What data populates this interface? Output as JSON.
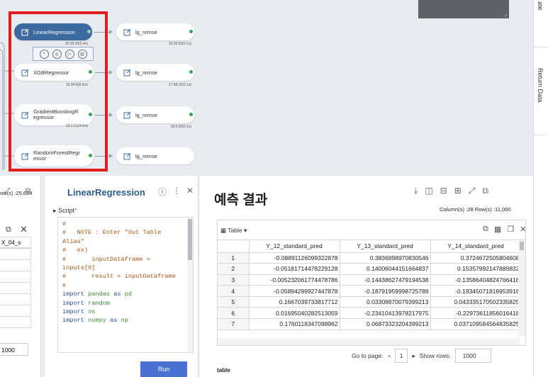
{
  "workflow": {
    "nodes": [
      {
        "label": "LinearRegression",
        "time": "16:26:39(5.4s)",
        "active": true
      },
      {
        "label": "XGBRegressor",
        "time": "16:34:6(8.9m)",
        "active": false
      },
      {
        "label": "GradientBoostingR\negressor",
        "time": "18:2:21(4.0m)",
        "active": false
      },
      {
        "label": "RandomForestRegr\nessor",
        "time": "",
        "active": false
      }
    ],
    "targets": [
      {
        "label": "lg_nrmse",
        "time": "16:26:53(0.1s)"
      },
      {
        "label": "lg_nrmse",
        "time": "17:58:15(0.1s)"
      },
      {
        "label": "lg_nrmse",
        "time": "18:5:39(0.1s)"
      },
      {
        "label": "lg_nrmse",
        "time": ""
      }
    ],
    "tool_icons": [
      "stop-icon",
      "group-icon",
      "play-icon",
      "delete-icon"
    ]
  },
  "side_tabs": [
    "ate",
    "Return Data"
  ],
  "left_panel": {
    "rows_text": "ow(s) :25,664",
    "column_header": "X_04_s",
    "page_size": "1000"
  },
  "script_panel": {
    "title": "LinearRegression",
    "script_label": "Script",
    "required_mark": "*",
    "code_lines": [
      {
        "type": "c",
        "text": "#"
      },
      {
        "type": "c",
        "text": "#   NOTE : Enter \"Out Table"
      },
      {
        "type": "c",
        "text": "Alias\""
      },
      {
        "type": "c",
        "text": "#   ex)"
      },
      {
        "type": "c",
        "text": "#       inputDataframe ="
      },
      {
        "type": "c",
        "text": "inputs[0]"
      },
      {
        "type": "c",
        "text": "#       result = inputDataframe"
      },
      {
        "type": "c",
        "text": "#"
      },
      {
        "type": "i",
        "kw": "import",
        "mod": "pandas",
        "as": "as",
        "alias": "pd"
      },
      {
        "type": "i",
        "kw": "import",
        "mod": "random",
        "as": "",
        "alias": ""
      },
      {
        "type": "i",
        "kw": "import",
        "mod": "os",
        "as": "",
        "alias": ""
      },
      {
        "type": "i",
        "kw": "import",
        "mod": "numpy",
        "as": "as",
        "alias": "np"
      }
    ],
    "run_label": "Run"
  },
  "result_panel": {
    "title": "예측 결과",
    "meta": "Column(s) :28   Row(s) :11,000",
    "table_label": "Table",
    "columns": [
      "",
      "Y_12_standard_pred",
      "Y_13_standard_pred",
      "Y_14_standard_pred"
    ],
    "rows": [
      [
        "1",
        "-0.08891126099322878",
        "0.3836898970830546",
        "0.3724672505804608"
      ],
      [
        "2",
        "-0.05181714478229128",
        "0.14006044151664837",
        "0.15357992147889832"
      ],
      [
        "3",
        "-0.005232061774478786",
        "-0.14438627479194538",
        "-0.13586404824766418"
      ],
      [
        "4",
        "-0.05894299927447878",
        "-0.18791959998725788",
        "-0.19345071816953918"
      ],
      [
        "5",
        "0.1667039733817712",
        "0.03308870079399213",
        "0.043335170502335825"
      ],
      [
        "6",
        "0.01695040282513059",
        "-0.23410413978217975",
        "-0.22973611856016418"
      ],
      [
        "7",
        "0.1760118347098962",
        "0.06873323204399213",
        "0.037109584564835825"
      ]
    ],
    "pager": {
      "goto_label": "Go to page:",
      "page": "1",
      "show_rows_label": "Show rows:",
      "rows_value": "1000"
    },
    "bottom_tab": "table"
  }
}
